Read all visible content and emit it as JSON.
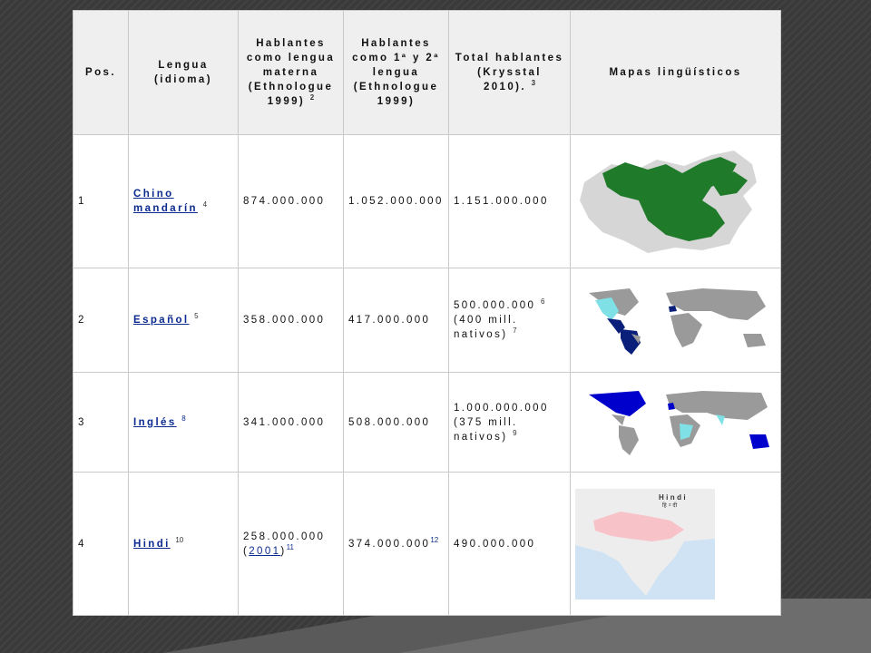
{
  "table": {
    "headers": {
      "pos": "Pos.",
      "lengua": "Lengua (idioma)",
      "hablantes_materna": "Hablantes como lengua materna (Ethnologue 1999)",
      "hablantes_materna_ref": "2",
      "hablantes_1y2": "Hablantes como 1ª y 2ª lengua (Ethnologue 1999)",
      "total": "Total hablantes (Krysstal 2010).",
      "total_ref": "3",
      "mapas": "Mapas lingüísticos"
    },
    "rows": [
      {
        "pos": "1",
        "lengua": "Chino mandarín",
        "lengua_ref": "4",
        "materna": "874.000.000",
        "primera_segunda": "1.052.000.000",
        "total": "1.151.000.000",
        "map_icon": "china-map"
      },
      {
        "pos": "2",
        "lengua": "Español",
        "lengua_ref": "5",
        "materna": "358.000.000",
        "primera_segunda": "417.000.000",
        "total": "500.000.000",
        "total_ref": "6",
        "total_note": "(400 mill. nativos)",
        "total_note_ref": "7",
        "map_icon": "world-map-spanish"
      },
      {
        "pos": "3",
        "lengua": "Inglés",
        "lengua_ref": "8",
        "materna": "341.000.000",
        "primera_segunda": "508.000.000",
        "total": "1.000.000.000",
        "total_note": "(375 mill. nativos)",
        "total_note_ref": "9",
        "map_icon": "world-map-english"
      },
      {
        "pos": "4",
        "lengua": "Hindi",
        "lengua_ref": "10",
        "materna": "258.000.000",
        "materna_year": "2001",
        "materna_ref": "11",
        "primera_segunda": "374.000.000",
        "primera_segunda_ref": "12",
        "total": "490.000.000",
        "map_icon": "india-map",
        "map_label": "Hindi",
        "map_label_sub": "हिन्दी"
      }
    ]
  },
  "colors": {
    "link": "#0b2a8f",
    "china_green": "#1f7a2a",
    "spanish_blue": "#0a1f7a",
    "english_blue": "#0000cc",
    "light_cyan": "#7fe0e6",
    "hindi_pink": "#f7c3c9"
  }
}
